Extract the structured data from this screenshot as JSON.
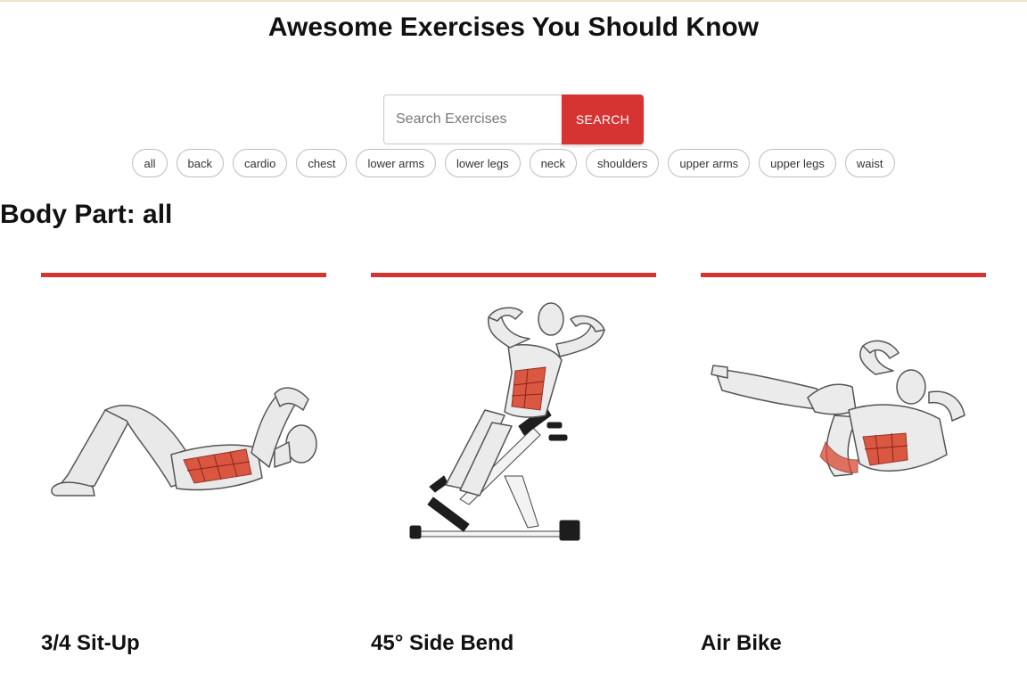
{
  "header": {
    "title": "Awesome Exercises You Should Know"
  },
  "search": {
    "placeholder": "Search Exercises",
    "value": "",
    "button_label": "SEARCH"
  },
  "body_parts": [
    "all",
    "back",
    "cardio",
    "chest",
    "lower arms",
    "lower legs",
    "neck",
    "shoulders",
    "upper arms",
    "upper legs",
    "waist"
  ],
  "section": {
    "title": "Body Part: all"
  },
  "exercises": [
    {
      "name": "3/4 Sit-Up",
      "image": "sit-up-illustration"
    },
    {
      "name": "45° Side Bend",
      "image": "side-bend-illustration"
    },
    {
      "name": "Air Bike",
      "image": "air-bike-illustration"
    }
  ],
  "colors": {
    "accent": "#d63333",
    "muscle_highlight": "#d9472f"
  }
}
